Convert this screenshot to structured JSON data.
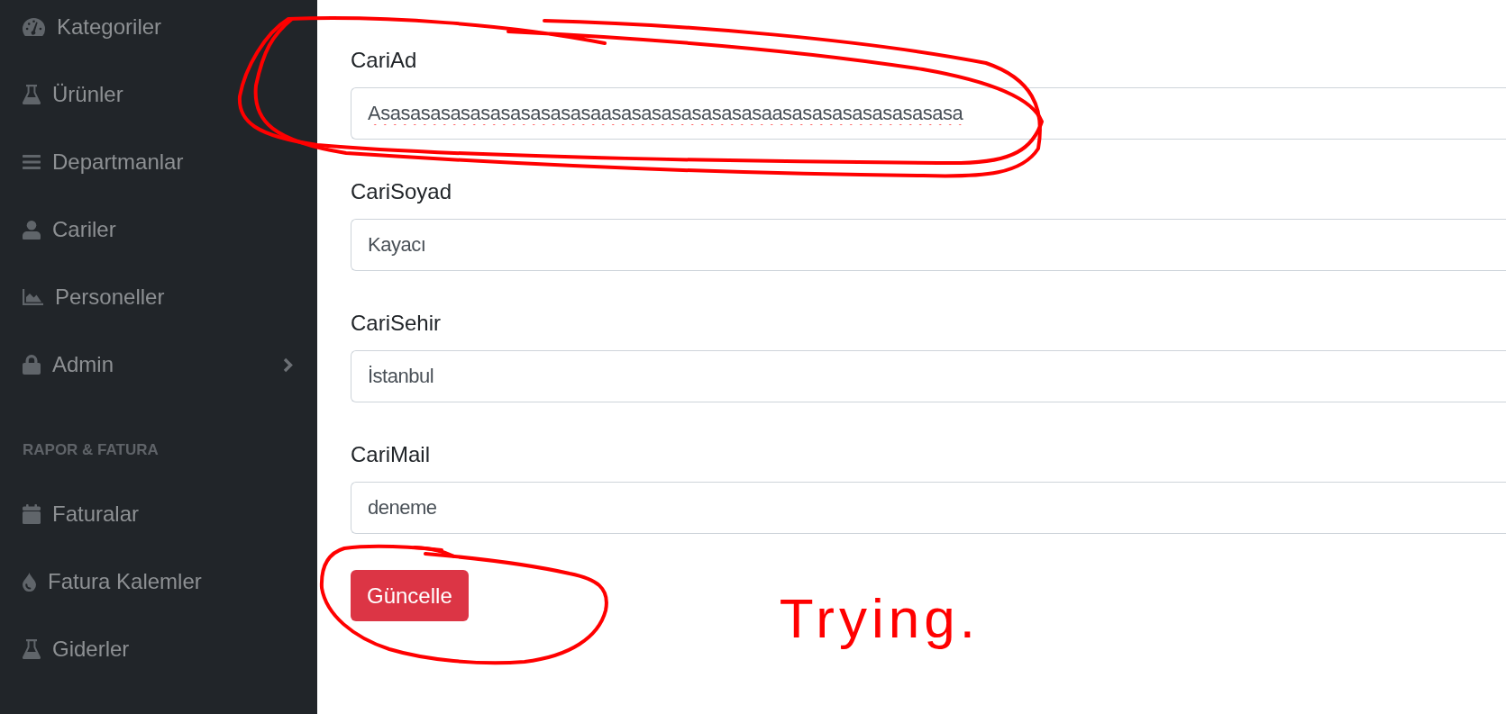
{
  "sidebar": {
    "sections": [
      {
        "items": [
          {
            "label": "Kategoriler",
            "submenu": false
          },
          {
            "label": "Ürünler",
            "submenu": false
          },
          {
            "label": "Departmanlar",
            "submenu": false
          },
          {
            "label": "Cariler",
            "submenu": false
          },
          {
            "label": "Personeller",
            "submenu": false
          },
          {
            "label": "Admin",
            "submenu": true
          }
        ]
      },
      {
        "heading": "RAPOR & FATURA",
        "items": [
          {
            "label": "Faturalar",
            "submenu": false
          },
          {
            "label": "Fatura Kalemler",
            "submenu": false
          },
          {
            "label": "Giderler",
            "submenu": false
          }
        ]
      }
    ]
  },
  "form": {
    "fields": [
      {
        "label": "CariAd",
        "value": "Asasasasasasasasasasasaasasasasasasasasaasasasasasasasasasa",
        "misspelled": true,
        "circled": true
      },
      {
        "label": "CariSoyad",
        "value": "Kayacı",
        "misspelled": false,
        "circled": false
      },
      {
        "label": "CariSehir",
        "value": "İstanbul",
        "misspelled": false,
        "circled": false
      },
      {
        "label": "CariMail",
        "value": "deneme",
        "misspelled": false,
        "circled": false
      }
    ],
    "submit": {
      "label": "Güncelle",
      "circled": true
    }
  },
  "annotation": {
    "note": "Trying."
  }
}
